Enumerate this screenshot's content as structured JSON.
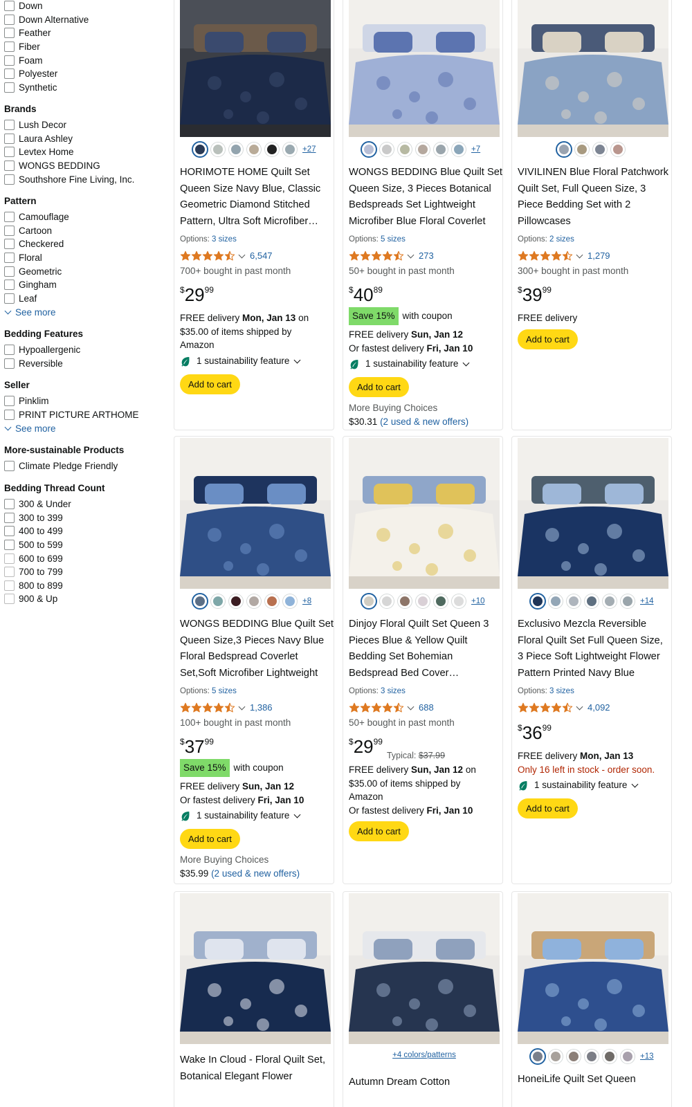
{
  "sidebar": {
    "material_items": [
      "Down",
      "Down Alternative",
      "Feather",
      "Fiber",
      "Foam",
      "Polyester",
      "Synthetic"
    ],
    "brands": {
      "heading": "Brands",
      "items": [
        "Lush Decor",
        "Laura Ashley",
        "Levtex Home",
        "WONGS BEDDING",
        "Southshore Fine Living, Inc."
      ]
    },
    "pattern": {
      "heading": "Pattern",
      "items": [
        "Camouflage",
        "Cartoon",
        "Checkered",
        "Floral",
        "Geometric",
        "Gingham",
        "Leaf"
      ],
      "see_more": "See more"
    },
    "bedding_features": {
      "heading": "Bedding Features",
      "items": [
        "Hypoallergenic",
        "Reversible"
      ]
    },
    "seller": {
      "heading": "Seller",
      "items": [
        "Pinklim",
        "PRINT PICTURE ARTHOME"
      ],
      "see_more": "See more"
    },
    "sustainable": {
      "heading": "More-sustainable Products",
      "items": [
        "Climate Pledge Friendly"
      ]
    },
    "thread_count": {
      "heading": "Bedding Thread Count",
      "items": [
        "300 & Under",
        "300 to 399",
        "400 to 499",
        "500 to 599",
        "600 to 699",
        "700 to 799",
        "800 to 899",
        "900 & Up"
      ]
    }
  },
  "products": [
    {
      "title": "HORIMOTE HOME Quilt Set Queen Size Navy Blue, Classic Geometric Diamond Stitched Pattern, Ultra Soft Microfiber Bedspread",
      "swatch_colors": [
        "#2a3a55",
        "#b9c0bb",
        "#93a4ae",
        "#b9ab98",
        "#222222",
        "#9aa9b0"
      ],
      "swatch_more": "+27",
      "options_prefix": "Options:",
      "options_link": "3 sizes",
      "rating": 4.5,
      "rating_count": "6,547",
      "bought": "700+ bought in past month",
      "price_symbol": "$",
      "price_whole": "29",
      "price_cents": "99",
      "delivery_1": "FREE delivery ",
      "delivery_1_bold": "Mon, Jan 13",
      "delivery_1_suffix": " on",
      "delivery_2": "$35.00 of items shipped by",
      "delivery_3": "Amazon",
      "sustainability": "1 sustainability feature",
      "button": "Add to cart"
    },
    {
      "title": "WONGS BEDDING Blue Quilt Set Queen Size, 3 Pieces Botanical Bedspreads Set Lightweight Microfiber Blue Floral Coverlet",
      "swatch_colors": [
        "#b8bfd6",
        "#c9c9c9",
        "#b7b9a2",
        "#b5a89e",
        "#9aa5ac",
        "#8ba6b9"
      ],
      "swatch_more": "+7",
      "options_prefix": "Options:",
      "options_link": "5 sizes",
      "rating": 4.5,
      "rating_count": "273",
      "bought": "50+ bought in past month",
      "price_symbol": "$",
      "price_whole": "40",
      "price_cents": "89",
      "save_badge": "Save 15%",
      "save_text": "with coupon",
      "delivery_1": "FREE delivery ",
      "delivery_1_bold": "Sun, Jan 12",
      "delivery_2": "Or fastest delivery ",
      "delivery_2_bold": "Fri, Jan 10",
      "sustainability": "1 sustainability feature",
      "button": "Add to cart",
      "mbc_label": "More Buying Choices",
      "mbc_price": "$30.31",
      "mbc_link": "(2 used & new offers)"
    },
    {
      "title": "VIVILINEN Blue Floral Patchwork Quilt Set, Full Queen Size, 3 Piece Bedding Set with 2 Pillowcases",
      "swatch_colors": [
        "#9aa3b0",
        "#a89a80",
        "#7d8593",
        "#b9968e"
      ],
      "options_prefix": "Options:",
      "options_link": "2 sizes",
      "rating": 4.5,
      "rating_count": "1,279",
      "bought": "300+ bought in past month",
      "price_symbol": "$",
      "price_whole": "39",
      "price_cents": "99",
      "delivery_1": "FREE delivery",
      "button": "Add to cart"
    },
    {
      "title": "WONGS BEDDING Blue Quilt Set Queen Size,3 Pieces Navy Blue Floral Bedspread Coverlet Set,Soft Microfiber Lightweight",
      "swatch_colors": [
        "#5c6f86",
        "#7ea7a8",
        "#3b1d22",
        "#b1a8a3",
        "#b8704f",
        "#8fb3d9"
      ],
      "swatch_more": "+8",
      "options_prefix": "Options:",
      "options_link": "5 sizes",
      "rating": 4.5,
      "rating_count": "1,386",
      "bought": "100+ bought in past month",
      "price_symbol": "$",
      "price_whole": "37",
      "price_cents": "99",
      "save_badge": "Save 15%",
      "save_text": "with coupon",
      "delivery_1": "FREE delivery ",
      "delivery_1_bold": "Sun, Jan 12",
      "delivery_2": "Or fastest delivery ",
      "delivery_2_bold": "Fri, Jan 10",
      "sustainability": "1 sustainability feature",
      "button": "Add to cart",
      "mbc_label": "More Buying Choices",
      "mbc_price": "$35.99",
      "mbc_link": "(2 used & new offers)"
    },
    {
      "title": "Dinjoy Floral Quilt Set Queen 3 Pieces Blue & Yellow Quilt Bedding Set Bohemian Bedspread Bed Cover Lightweight",
      "swatch_colors": [
        "#d0cdc3",
        "#d6d6d6",
        "#8d7568",
        "#d9d0d6",
        "#4f6a5f",
        "#dcdcdc"
      ],
      "swatch_more": "+10",
      "options_prefix": "Options:",
      "options_link": "3 sizes",
      "rating": 4.5,
      "rating_count": "688",
      "bought": "50+ bought in past month",
      "price_symbol": "$",
      "price_whole": "29",
      "price_cents": "99",
      "typical_label": "Typical: ",
      "typical_price": "$37.99",
      "delivery_1": "FREE delivery ",
      "delivery_1_bold": "Sun, Jan 12",
      "delivery_1_suffix": " on",
      "delivery_2": "$35.00 of items shipped by",
      "delivery_3": "Amazon",
      "delivery_4": "Or fastest delivery ",
      "delivery_4_bold": "Fri, Jan 10",
      "button": "Add to cart"
    },
    {
      "title": "Exclusivo Mezcla Reversible Floral Quilt Set Full Queen Size, 3 Piece Soft Lightweight Flower Pattern Printed Navy Blue",
      "swatch_colors": [
        "#1f3558",
        "#93a6b6",
        "#aeb5bd",
        "#5e6f80",
        "#a4adb3",
        "#9aa5ab"
      ],
      "swatch_more": "+14",
      "options_prefix": "Options:",
      "options_link": "3 sizes",
      "rating": 4.5,
      "rating_count": "4,092",
      "price_symbol": "$",
      "price_whole": "36",
      "price_cents": "99",
      "delivery_1": "FREE delivery ",
      "delivery_1_bold": "Mon, Jan 13",
      "stock": "Only 16 left in stock - order soon.",
      "sustainability": "1 sustainability feature",
      "button": "Add to cart"
    },
    {
      "title": "Wake In Cloud - Floral Quilt Set, Botanical Elegant Flower"
    },
    {
      "colors_link": "+4 colors/patterns",
      "title": "Autumn Dream Cotton"
    },
    {
      "title": "HoneiLife Quilt Set Queen",
      "swatch_colors": [
        "#7a808c",
        "#a8a19b",
        "#8c7f78",
        "#7c7e86",
        "#6f6b67",
        "#a8a0ac"
      ],
      "swatch_more": "+13"
    }
  ],
  "colors": {
    "link": "#2162a1",
    "star": "#de7921",
    "button": "#ffd814",
    "save": "#7fda69",
    "stock_red": "#b12704",
    "leaf": "#067d62"
  }
}
